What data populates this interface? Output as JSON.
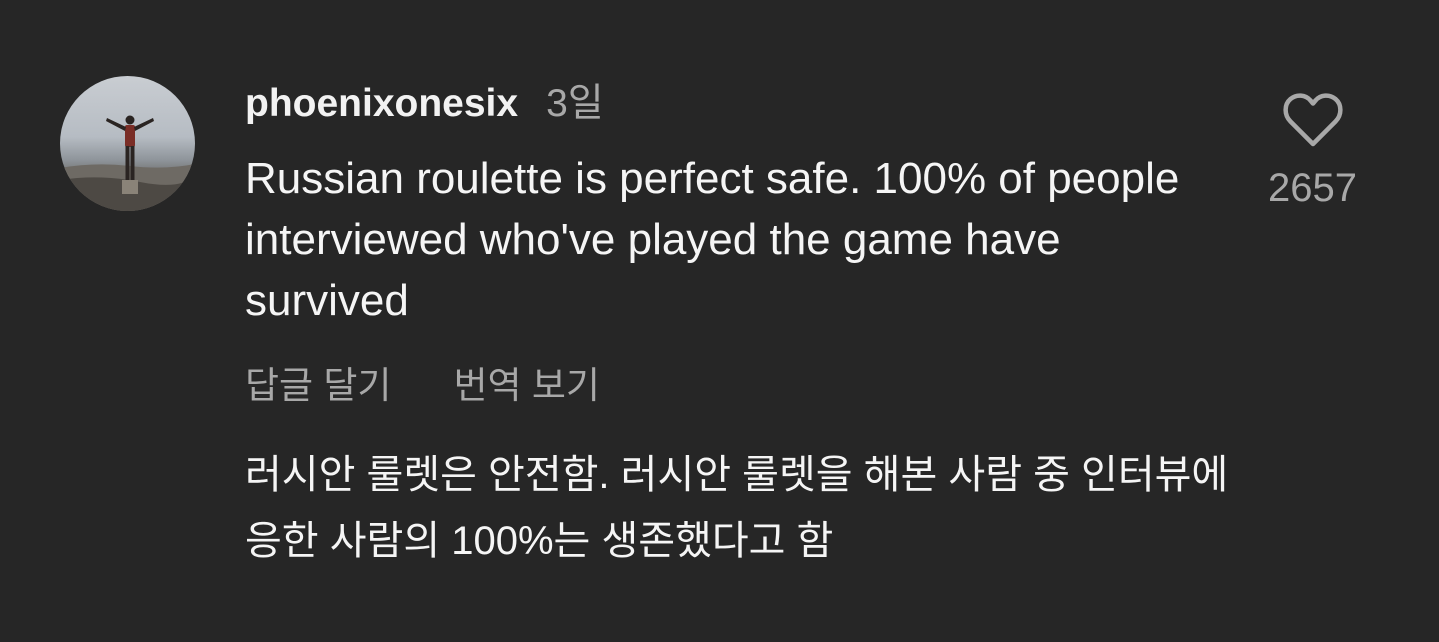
{
  "comment": {
    "username": "phoenixonesix",
    "timestamp": "3일",
    "text": "Russian roulette is perfect safe. 100% of people interviewed who've played the game have survived",
    "actions": {
      "reply_label": "답글 달기",
      "translate_label": "번역 보기"
    },
    "translation": "러시안 룰렛은 안전함. 러시안 룰렛을 해본 사람 중 인터뷰에 응한 사람의 100%는 생존했다고 함",
    "likes": {
      "count": "2657",
      "icon": "heart-outline-icon"
    }
  },
  "colors": {
    "background": "#262626",
    "primary_text": "#f5f5f5",
    "secondary_text": "#a8a8a8"
  }
}
